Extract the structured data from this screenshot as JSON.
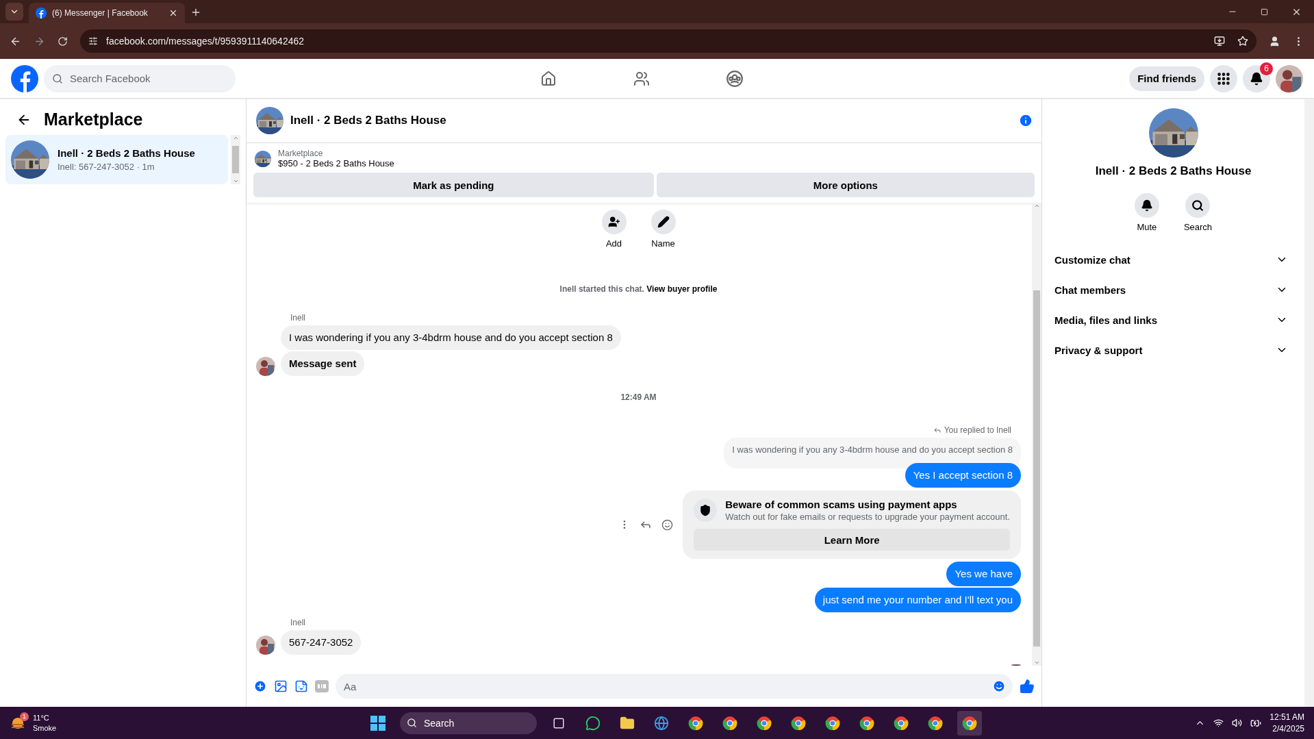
{
  "browser": {
    "tab_title": "(6) Messenger | Facebook",
    "url": "facebook.com/messages/t/9593911140642462"
  },
  "header": {
    "search_placeholder": "Search Facebook",
    "find_friends": "Find friends",
    "notification_count": "6"
  },
  "sidebar": {
    "title": "Marketplace",
    "conversations": [
      {
        "title": "Inell · 2 Beds 2 Baths House",
        "preview": "Inell: 567-247-3052 · 1m",
        "selected": true
      }
    ]
  },
  "chat": {
    "title": "Inell · 2 Beds 2 Baths House",
    "listing": {
      "label": "Marketplace",
      "text": "$950 - 2 Beds 2 Baths House"
    },
    "actions": [
      "Mark as pending",
      "More options"
    ],
    "quick_actions": [
      {
        "kind": "add",
        "label": "Add"
      },
      {
        "kind": "name",
        "label": "Name"
      }
    ],
    "messages": [
      {
        "kind": "system",
        "text": "Inell started this chat.",
        "link": "View buyer profile"
      },
      {
        "kind": "incoming",
        "sender": "Inell",
        "bubbles": [
          {
            "text": "I was wondering if you any 3-4bdrm house and do you accept section 8",
            "bold": false
          },
          {
            "text": "Message sent",
            "bold": true
          }
        ]
      },
      {
        "kind": "timestamp",
        "text": "12:49 AM"
      },
      {
        "kind": "reply",
        "label": "You replied to Inell",
        "quote": "I was wondering if you any 3-4bdrm house and do you accept section 8",
        "text": "Yes I accept section 8"
      },
      {
        "kind": "notice",
        "title": "Beware of common scams using payment apps",
        "text": "Watch out for fake emails or requests to upgrade your payment account.",
        "button": "Learn More"
      },
      {
        "kind": "outgoing",
        "bubbles": [
          {
            "text": "Yes we have",
            "bold": false
          },
          {
            "text": "just send me your number and I'll text you",
            "bold": false
          }
        ]
      },
      {
        "kind": "incoming",
        "sender": "Inell",
        "bubbles": [
          {
            "text": "567-247-3052",
            "bold": false
          }
        ]
      }
    ],
    "composer": {
      "placeholder": "Aa"
    }
  },
  "details": {
    "title": "Inell · 2 Beds 2 Baths House",
    "actions": [
      {
        "kind": "mute",
        "label": "Mute"
      },
      {
        "kind": "search",
        "label": "Search"
      }
    ],
    "sections": [
      {
        "label": "Customize chat",
        "expanded": false
      },
      {
        "label": "Chat members",
        "expanded": false
      },
      {
        "label": "Media, files and links",
        "expanded": false
      },
      {
        "label": "Privacy & support",
        "expanded": false
      }
    ]
  },
  "taskbar": {
    "weather_badge": "1",
    "temperature": "11°C",
    "condition": "Smoke",
    "search_placeholder": "Search",
    "time": "12:51 AM",
    "date": "2/4/2025"
  }
}
